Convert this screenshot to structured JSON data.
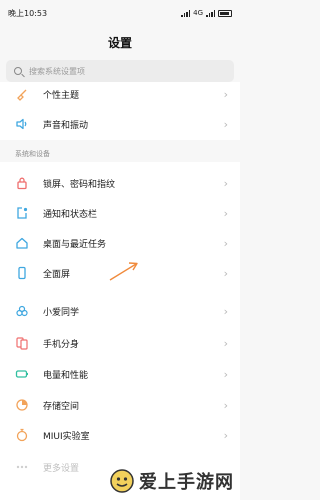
{
  "status_bar": {
    "time": "晚上10:53",
    "network": "4G"
  },
  "header": {
    "title": "设置"
  },
  "search": {
    "placeholder": "搜索系统设置项"
  },
  "colors": {
    "theme": "#f2a35a",
    "sound": "#3fa7e0",
    "lock": "#ef6e6e",
    "notify": "#3fa7e0",
    "desktop": "#3fa7e0",
    "fullscreen": "#3fa7e0",
    "ai": "#3fa7e0",
    "dual": "#ef6e6e",
    "battery": "#31bfa0",
    "storage": "#f2a35a",
    "miui": "#f2a35a",
    "more": "#cfcfcf",
    "arrow": "#f08a3c"
  },
  "items_top": [
    {
      "label": "个性主题",
      "icon": "brush-icon"
    },
    {
      "label": "声音和振动",
      "icon": "speaker-icon"
    }
  ],
  "section": {
    "label": "系统和设备"
  },
  "items": [
    {
      "label": "锁屏、密码和指纹",
      "icon": "lock-icon"
    },
    {
      "label": "通知和状态栏",
      "icon": "notification-icon"
    },
    {
      "label": "桌面与最近任务",
      "icon": "home-icon"
    },
    {
      "label": "全面屏",
      "icon": "phone-icon"
    },
    {
      "label": "小爱同学",
      "icon": "assistant-icon"
    },
    {
      "label": "手机分身",
      "icon": "dual-phone-icon"
    },
    {
      "label": "电量和性能",
      "icon": "battery-icon"
    },
    {
      "label": "存储空间",
      "icon": "storage-pie-icon"
    },
    {
      "label": "MIUI实验室",
      "icon": "flask-icon"
    },
    {
      "label": "更多设置",
      "icon": "more-dots-icon"
    }
  ],
  "watermark": {
    "text": "爱上手游网"
  }
}
